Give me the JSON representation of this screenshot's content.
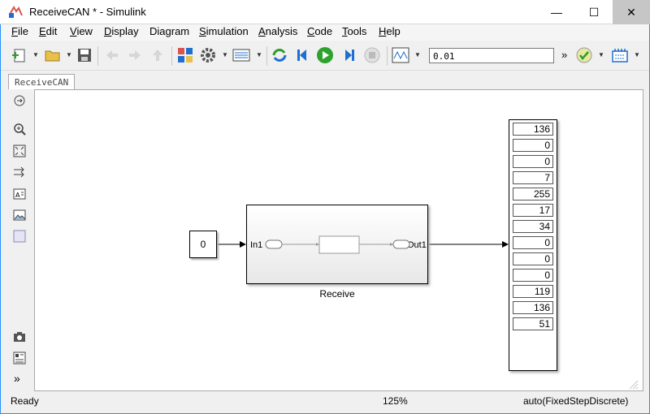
{
  "window": {
    "title": "ReceiveCAN * - Simulink",
    "min_glyph": "—",
    "max_glyph": "☐",
    "close_glyph": "✕"
  },
  "menu": [
    "File",
    "Edit",
    "View",
    "Display",
    "Diagram",
    "Simulation",
    "Analysis",
    "Code",
    "Tools",
    "Help"
  ],
  "menu_mnemonics": [
    "F",
    "E",
    "V",
    "D",
    "g",
    "S",
    "A",
    "C",
    "T",
    "H"
  ],
  "toolbar": {
    "stop_time": "0.01",
    "more": "»"
  },
  "tabs": [
    "ReceiveCAN"
  ],
  "model": {
    "constant_value": "0",
    "subsystem_name": "Receive",
    "inport_label": "In1",
    "outport_label": "Out1",
    "display_values": [
      "136",
      "0",
      "0",
      "7",
      "255",
      "17",
      "34",
      "0",
      "0",
      "0",
      "119",
      "136",
      "51"
    ]
  },
  "status": {
    "left": "Ready",
    "zoom": "125%",
    "solver": "auto(FixedStepDiscrete)"
  },
  "palette": {
    "more": "»"
  },
  "colors": {
    "accent": "#1e90ff",
    "run_green": "#2ea22e",
    "close_hover": "#c6c6c6"
  }
}
